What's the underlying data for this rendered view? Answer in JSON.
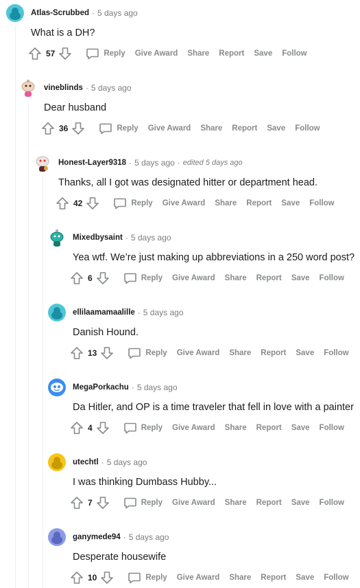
{
  "actions": {
    "reply": "Reply",
    "give_award": "Give Award",
    "share": "Share",
    "report": "Report",
    "save": "Save",
    "follow": "Follow"
  },
  "comments": [
    {
      "author": "Atlas-Scrubbed",
      "sep": "·",
      "time": "5 days ago",
      "body": "What is a DH?",
      "score": "57",
      "avatar_icon": "teal-snoo-avatar-icon",
      "avatar_color": "#4fc6d8"
    },
    {
      "author": "vineblinds",
      "sep": "·",
      "time": "5 days ago",
      "body": "Dear husband",
      "score": "36",
      "avatar_icon": "custom-snoo-avatar-icon",
      "avatar_color": "#f1d5c0"
    },
    {
      "author": "Honest-Layer9318",
      "sep": "·",
      "time": "5 days ago",
      "edited": "edited 5 days ago",
      "body": "Thanks, all I got was designated hitter or department head.",
      "score": "42",
      "avatar_icon": "custom-snoo-avatar-icon",
      "avatar_color": "#f3e3df"
    },
    {
      "author": "Mixedbysaint",
      "sep": "·",
      "time": "5 days ago",
      "body": "Yea wtf. We’re just making up abbreviations in a 250 word post?",
      "score": "6",
      "avatar_icon": "custom-snoo-avatar-icon",
      "avatar_color": "#2bb3a3"
    },
    {
      "author": "ellilaamamaalille",
      "sep": "·",
      "time": "5 days ago",
      "body": "Danish Hound.",
      "score": "13",
      "avatar_icon": "teal-snoo-avatar-icon",
      "avatar_color": "#4fc6d8"
    },
    {
      "author": "MegaPorkachu",
      "sep": "·",
      "time": "5 days ago",
      "body": "Da Hitler, and OP is a time traveler that fell in love with a painter",
      "score": "4",
      "avatar_icon": "blue-snoo-avatar-icon",
      "avatar_color": "#3b8ef0"
    },
    {
      "author": "utechtl",
      "sep": "·",
      "time": "5 days ago",
      "body": "I was thinking Dumbass Hubby...",
      "score": "7",
      "avatar_icon": "yellow-snoo-avatar-icon",
      "avatar_color": "#f5c518"
    },
    {
      "author": "ganymede94",
      "sep": "·",
      "time": "5 days ago",
      "body": "Desperate housewife",
      "score": "10",
      "avatar_icon": "purple-snoo-avatar-icon",
      "avatar_color": "#8c9ae6"
    }
  ]
}
